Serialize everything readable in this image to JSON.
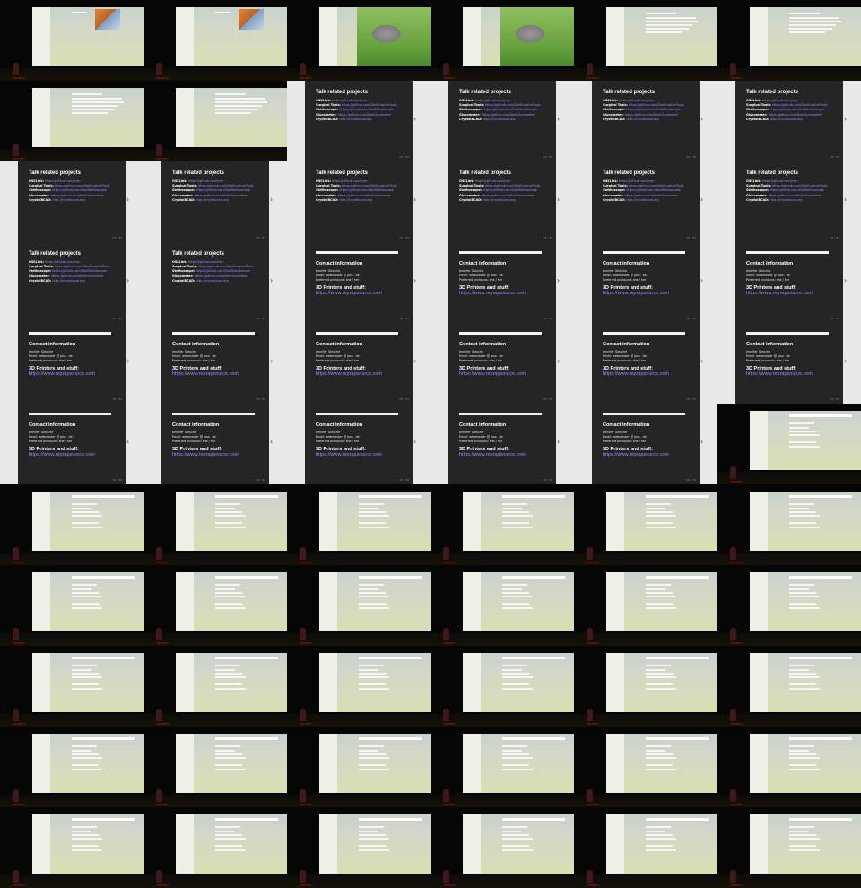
{
  "slides": {
    "projects": {
      "title": "Talk related projects",
      "items": [
        {
          "k": "OSSLink:",
          "v": "https://github.com/jnsn"
        },
        {
          "k": "Surgical Tools:",
          "v": "https://github.com/SkelSurgicalTools"
        },
        {
          "k": "Stethoscope:",
          "v": "https://github.com/SkelStethoscope"
        },
        {
          "k": "Glucometer:",
          "v": "https://github.com/SkelGlucometer"
        },
        {
          "k": "CrystalBCAD:",
          "v": "http://crystalscad.org"
        }
      ],
      "pager": "34 / 35"
    },
    "contact": {
      "title": "Contact information",
      "name": "Jennifer Gleuche",
      "email": "Email: webmaster @ joss . de",
      "pronouns": "Preferred pronouns: she / her",
      "printers_heading": "3D Printers and stuff:",
      "printers_link": "https://www.reprapsource.com",
      "pager": "35 / 35"
    }
  },
  "stage": {
    "logo_text": "TEDMED"
  }
}
